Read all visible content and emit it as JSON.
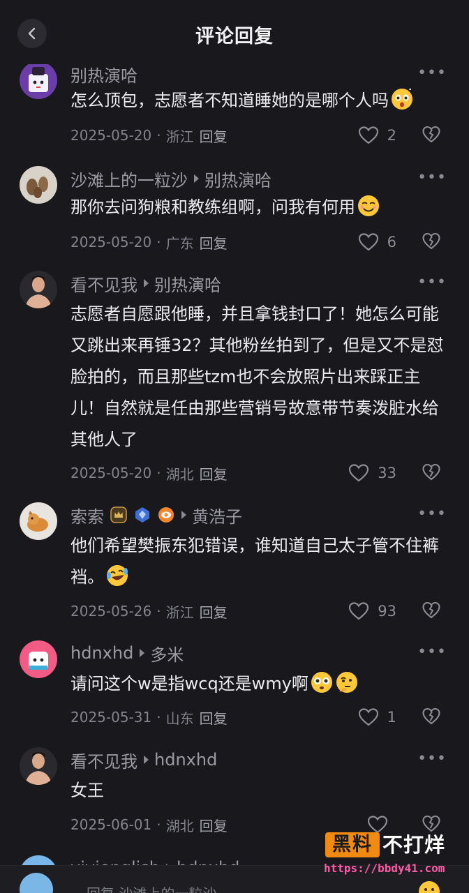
{
  "header": {
    "title": "评论回复"
  },
  "comments": [
    {
      "username": "别热演哈",
      "reply_to": "",
      "text": "怎么顶包，志愿者不知道睡她的是哪个人吗",
      "emoji": "surprised-face-emoji",
      "date": "2025-05-20",
      "location": "浙江",
      "reply_label": "回复",
      "likes": "2",
      "avatar": "cartoon-avatar-purple"
    },
    {
      "username": "沙滩上的一粒沙",
      "reply_to": "别热演哈",
      "text": "那你去问狗粮和教练组啊，问我有何用",
      "emoji": "smiling-face-emoji",
      "date": "2025-05-20",
      "location": "广东",
      "reply_label": "回复",
      "likes": "6",
      "avatar": "photo-avatar-shells"
    },
    {
      "username": "看不见我",
      "reply_to": "别热演哈",
      "text": "志愿者自愿跟他睡，并且拿钱封口了！她怎么可能又跳出来再锤32？其他粉丝拍到了，但是又不是怼脸拍的，而且那些tzm也不会放照片出来踩正主儿！自然就是任由那些营销号故意带节奏泼脏水给其他人了",
      "emoji": "",
      "date": "2025-05-20",
      "location": "湖北",
      "reply_label": "回复",
      "likes": "33",
      "avatar": "photo-avatar-man"
    },
    {
      "username": "索索",
      "reply_to": "黄浩子",
      "text": "他们希望樊振东犯错误，谁知道自己太子管不住裤裆。",
      "emoji": "crying-laughing-emoji",
      "date": "2025-05-26",
      "location": "浙江",
      "reply_label": "回复",
      "likes": "93",
      "avatar": "photo-avatar-dog",
      "badges": [
        "crown-badge-icon",
        "diamond-badge-icon",
        "eye-badge-icon"
      ]
    },
    {
      "username": "hdnxhd",
      "reply_to": "多米",
      "text": "请问这个w是指wcq还是wmy啊",
      "emoji": "flushed-face-emoji",
      "emoji2": "thinking-face-emoji",
      "date": "2025-05-31",
      "location": "山东",
      "reply_label": "回复",
      "likes": "1",
      "avatar": "cartoon-avatar-pink"
    },
    {
      "username": "看不见我",
      "reply_to": "hdnxhd",
      "text": "女王",
      "emoji": "",
      "date": "2025-06-01",
      "location": "湖北",
      "reply_label": "回复",
      "likes": "",
      "avatar": "photo-avatar-man"
    },
    {
      "username": "yiyienglish",
      "reply_to": "hdnxhd",
      "avatar": "cartoon-avatar-blue"
    }
  ],
  "footer": {
    "placeholder": "回复 沙滩上的一粒沙"
  },
  "watermark": {
    "brand_box": "黑料",
    "brand_text": "不打烊",
    "url": "https://bbdy41.com"
  },
  "colors": {
    "background": "#18181d",
    "text": "#ececef",
    "muted": "#84848c",
    "watermark_orange": "#f08a10",
    "watermark_pink": "#ff5aa8"
  }
}
